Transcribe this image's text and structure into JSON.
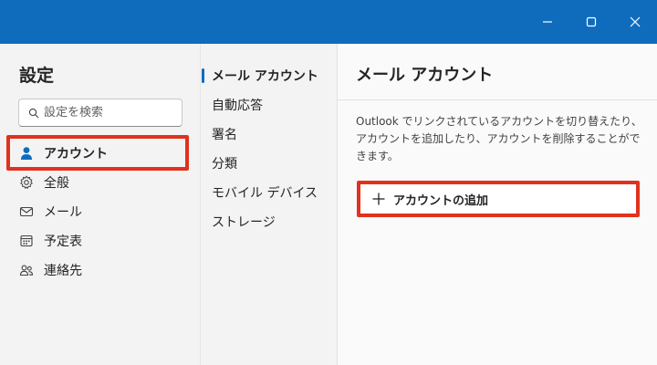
{
  "window": {
    "minimize_glyph": "minimize-icon",
    "maximize_glyph": "maximize-icon",
    "close_glyph": "close-icon"
  },
  "sidebar": {
    "title": "設定",
    "search_placeholder": "設定を検索",
    "items": [
      {
        "label": "アカウント",
        "icon": "person-icon",
        "active": true
      },
      {
        "label": "全般",
        "icon": "gear-icon",
        "active": false
      },
      {
        "label": "メール",
        "icon": "mail-icon",
        "active": false
      },
      {
        "label": "予定表",
        "icon": "calendar-icon",
        "active": false
      },
      {
        "label": "連絡先",
        "icon": "people-icon",
        "active": false
      }
    ]
  },
  "subnav": {
    "items": [
      {
        "label": "メール アカウント",
        "active": true
      },
      {
        "label": "自動応答",
        "active": false
      },
      {
        "label": "署名",
        "active": false
      },
      {
        "label": "分類",
        "active": false
      },
      {
        "label": "モバイル デバイス",
        "active": false
      },
      {
        "label": "ストレージ",
        "active": false
      }
    ]
  },
  "content": {
    "title": "メール アカウント",
    "description": "Outlook でリンクされているアカウントを切り替えたり、アカウントを追加したり、アカウントを削除することができます。",
    "add_account_label": "アカウントの追加"
  },
  "colors": {
    "titlebar": "#0f6cbd",
    "highlight": "#e0321e",
    "accent": "#0f6cbd"
  }
}
